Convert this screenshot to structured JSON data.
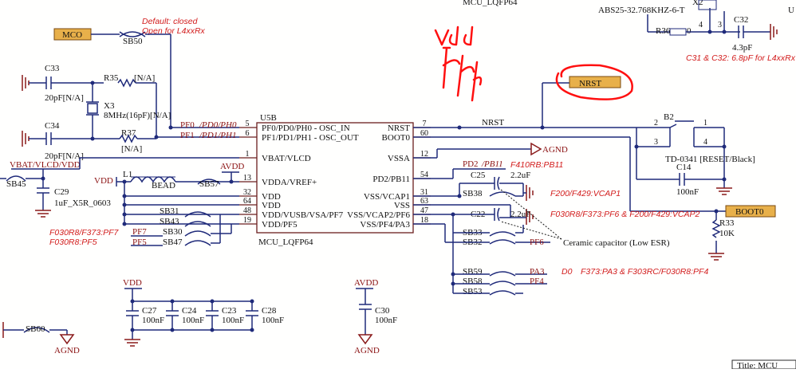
{
  "top": {
    "mcu_partial": "MCU_LQFP64",
    "xtal_part": "ABS25-32.768KHZ-6-T",
    "x2": "X2",
    "cut_u": "U",
    "title_block": "Title: MCU"
  },
  "ic": {
    "ref": "U5B",
    "footer": "MCU_LQFP64",
    "left_pins": [
      {
        "num": "5",
        "name": "PF0/PD0/PH0 - OSC_IN"
      },
      {
        "num": "6",
        "name": "PF1/PD1/PH1 - OSC_OUT"
      },
      {
        "num": "1",
        "name": "VBAT/VLCD"
      },
      {
        "num": "13",
        "name": "VDDA/VREF+"
      },
      {
        "num": "32",
        "name": "VDD"
      },
      {
        "num": "64",
        "name": "VDD"
      },
      {
        "num": "48",
        "name": "VDD/VUSB/VSA/PF7"
      },
      {
        "num": "19",
        "name": "VDD/PF5"
      }
    ],
    "right_pins": [
      {
        "num": "7",
        "name": "NRST"
      },
      {
        "num": "60",
        "name": "BOOT0"
      },
      {
        "num": "12",
        "name": "VSSA"
      },
      {
        "num": "54",
        "name": "PD2/PB11"
      },
      {
        "num": "31",
        "name": "VSS/VCAP1"
      },
      {
        "num": "63",
        "name": "VSS"
      },
      {
        "num": "47",
        "name": "VSS/VCAP2/PF6"
      },
      {
        "num": "18",
        "name": "VSS/PF4/PA3"
      }
    ]
  },
  "nets": {
    "mco": "MCO",
    "pf0": "PF0",
    "pf0_alt": "/PD0/PH0",
    "pf1": "PF1",
    "pf1_alt": "/PD1/PH1",
    "nrst": "NRST",
    "nrst_port": "NRST",
    "boot0": "BOOT0",
    "agnd": "AGND",
    "avdd": "AVDD",
    "vdd": "VDD",
    "vbat": "VBAT/VLCD/VDD",
    "pd2": "PD2",
    "pd2_alt": "/PB11",
    "pf7": "PF7",
    "pf5": "PF5",
    "pf6": "PF6",
    "pa3": "PA3",
    "pf4": "PF4"
  },
  "components": {
    "c33": "C33",
    "c33_val": "20pF[N/A]",
    "r35": "R35",
    "r35_val": "[N/A]",
    "x3": "X3",
    "x3_val": "8MHz(16pF)[N/A]",
    "c34": "C34",
    "c34_val": "20pF[N/A]",
    "r37": "R37",
    "r37_val": "[N/A]",
    "sb50": "SB50",
    "sb45": "SB45",
    "c29": "C29",
    "c29_val": "1uF_X5R_0603",
    "l1": "L1",
    "l1_val": "BEAD",
    "sb57": "SB57",
    "sb31": "SB31",
    "sb43": "SB43",
    "sb30": "SB30",
    "sb47": "SB47",
    "c25": "C25",
    "c25_val": "2.2uF",
    "c22": "C22",
    "c22_val": "2.2uF",
    "sb38": "SB38",
    "sb33": "SB33",
    "sb32": "SB32",
    "sb59": "SB59",
    "sb58": "SB58",
    "sb53": "SB53",
    "b2": "B2",
    "b2_val": "TD-0341 [RESET/Black]",
    "c14": "C14",
    "c14_val": "100nF",
    "r33": "R33",
    "r33_val": "10K",
    "r36": "R36",
    "r36_val": "0",
    "c32": "C32",
    "c32_val": "4.3pF",
    "c27": "C27",
    "c24": "C24",
    "c23": "C23",
    "c28": "C28",
    "c30": "C30",
    "cap_val": "100nF",
    "sb60": "SB60",
    "b2_p1": "1",
    "b2_p2": "2",
    "b2_p3": "3",
    "b2_p4": "4",
    "x2_p4": "4",
    "x2_p3": "3"
  },
  "notes": {
    "sb50_default": "Default: closed",
    "sb50_open": "Open for L4xxRx",
    "c31_c32": "C31 & C32: 6.8pF for L4xxRx",
    "pf7_note": "F030R8/F373:PF7",
    "pf5_note": "F030R8:PF5",
    "pb11_note": "F410RB:PB11",
    "vcap1_note": "F200/F429:VCAP1",
    "vcap2_note": "F030R8/F373:PF6 & F200/F429:VCAP2",
    "ceramic": "Ceramic capacitor (Low ESR)",
    "pa3_note_d0": "D0",
    "pa3_note": "F373:PA3 & F303RC/F030R8:PF4"
  },
  "annotation": {
    "handwritten": "Vdd / Vddx",
    "color": "#ff1010"
  },
  "colors": {
    "wire": "#1f2a7a",
    "pin_number": "#8a1010",
    "note": "#d21c1c",
    "port_fill": "#e8b04a"
  }
}
